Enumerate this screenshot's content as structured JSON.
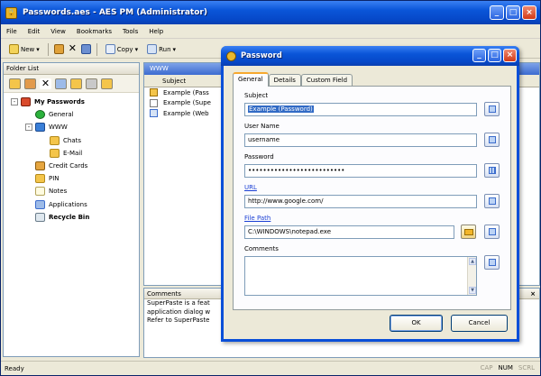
{
  "app": {
    "title": "Passwords.aes - AES PM (Administrator)",
    "icon": "lock-icon"
  },
  "menubar": [
    "File",
    "Edit",
    "View",
    "Bookmarks",
    "Tools",
    "Help"
  ],
  "toolbar": {
    "new_label": "New",
    "copy_label": "Copy",
    "run_label": "Run"
  },
  "folder_panel": {
    "title": "Folder List",
    "tree": [
      {
        "label": "My Passwords",
        "level": 0,
        "expander": "-",
        "bold": true,
        "icon": "home-icon"
      },
      {
        "label": "General",
        "level": 1,
        "icon": "check-icon"
      },
      {
        "label": "WWW",
        "level": 1,
        "expander": "-",
        "icon": "globe-icon"
      },
      {
        "label": "Chats",
        "level": 2,
        "icon": "folder-icon"
      },
      {
        "label": "E-Mail",
        "level": 2,
        "icon": "folder-icon"
      },
      {
        "label": "Credit Cards",
        "level": 1,
        "icon": "card-icon"
      },
      {
        "label": "PIN",
        "level": 1,
        "icon": "folder-icon"
      },
      {
        "label": "Notes",
        "level": 1,
        "icon": "notes-icon"
      },
      {
        "label": "Applications",
        "level": 1,
        "icon": "app-icon"
      },
      {
        "label": "Recycle Bin",
        "level": 1,
        "bold": true,
        "icon": "recycle-bin-icon"
      }
    ]
  },
  "list_panel": {
    "title": "WWW",
    "column_subject": "Subject",
    "rows": [
      "Example (Pass",
      "Example (Supe",
      "Example (Web"
    ]
  },
  "comments_panel": {
    "title": "Comments",
    "close": "×",
    "lines": [
      "SuperPaste is a feat",
      "application dialog w",
      "Refer to SuperPaste"
    ]
  },
  "statusbar": {
    "text": "Ready",
    "cap": "CAP",
    "num": "NUM",
    "scrl": "SCRL"
  },
  "dialog": {
    "title": "Password",
    "tabs": [
      "General",
      "Details",
      "Custom Field"
    ],
    "active_tab": "General",
    "fields": {
      "subject_label": "Subject",
      "subject_value": "Example (Password)",
      "username_label": "User Name",
      "username_value": "username",
      "password_label": "Password",
      "password_value": "••••••••••••••••••••••••••",
      "url_label": "URL",
      "url_value": "http://www.google.com/",
      "filepath_label": "File Path",
      "filepath_value": "C:\\WINDOWS\\notepad.exe",
      "comments_label": "Comments"
    },
    "ok_label": "OK",
    "cancel_label": "Cancel"
  },
  "colors": {
    "xp_blue": "#0a55d8",
    "selection": "#316ac5",
    "link": "#1a3fd4"
  }
}
